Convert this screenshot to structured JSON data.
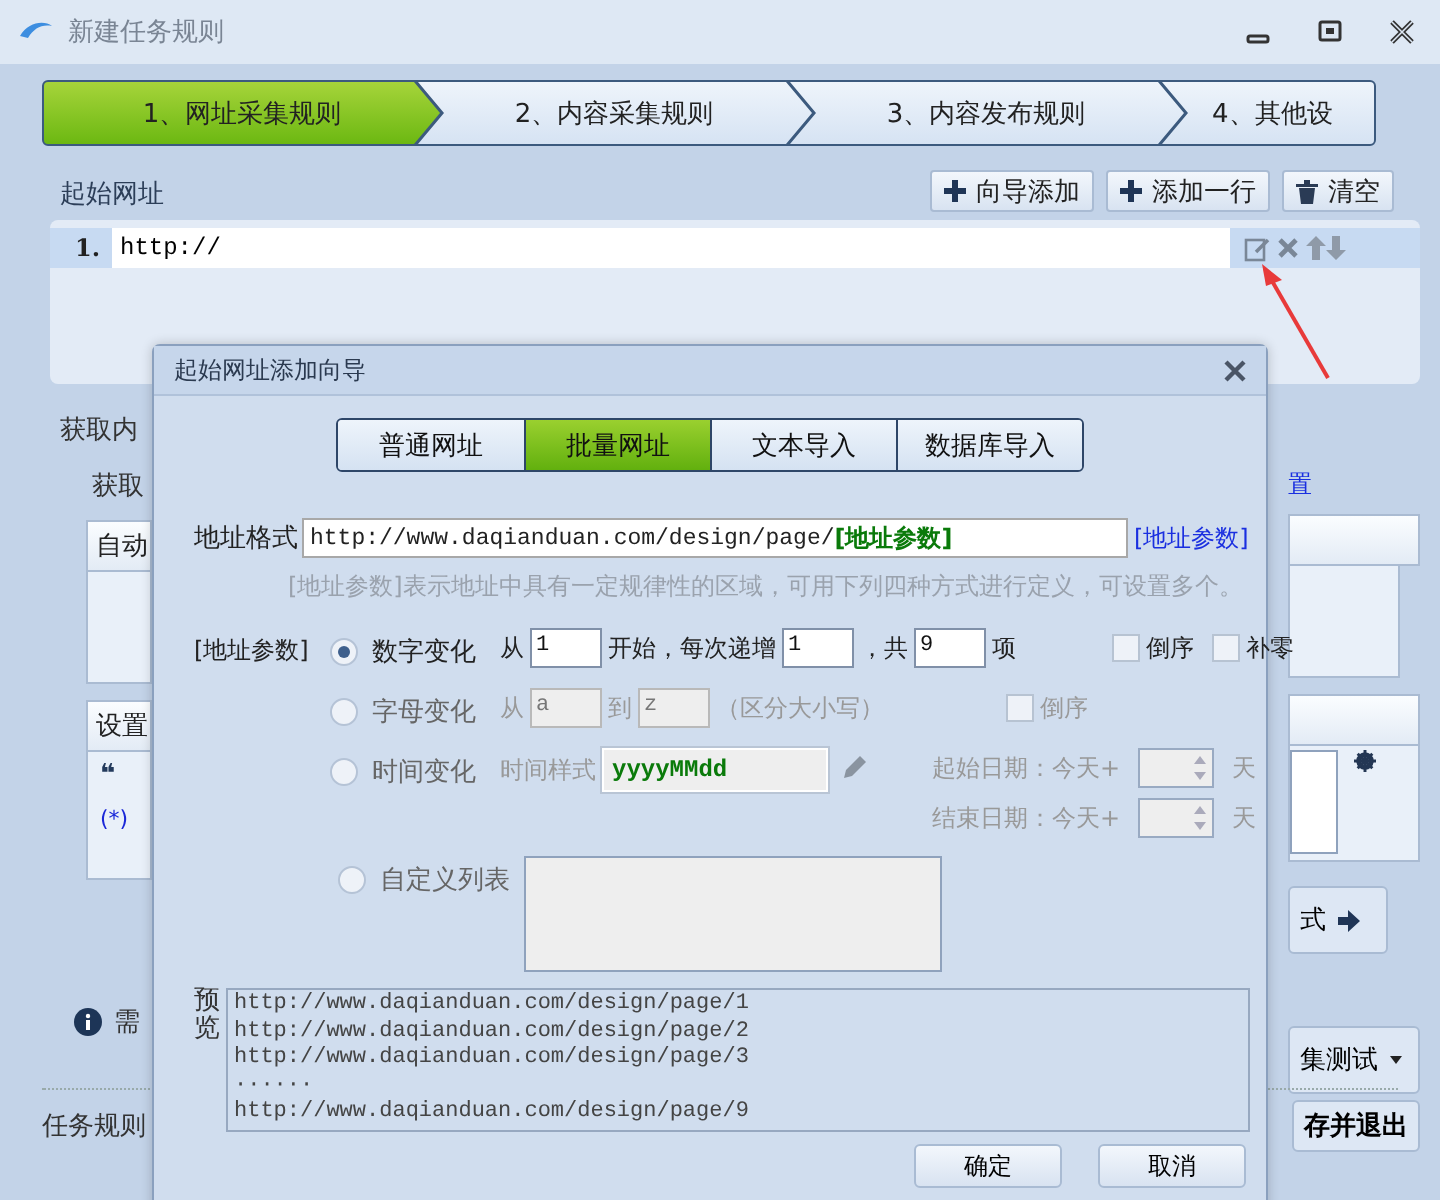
{
  "window": {
    "title": "新建任务规则"
  },
  "steps": [
    {
      "label": "1、网址采集规则",
      "selected": true
    },
    {
      "label": "2、内容采集规则",
      "selected": false
    },
    {
      "label": "3、内容发布规则",
      "selected": false
    },
    {
      "label": "4、其他设",
      "selected": false
    }
  ],
  "start_urls": {
    "title": "起始网址",
    "buttons": [
      {
        "label": "向导添加",
        "kind": "plus"
      },
      {
        "label": "添加一行",
        "kind": "plus"
      },
      {
        "label": "清空",
        "kind": "trash"
      }
    ],
    "rows": [
      {
        "index": "1.",
        "value": "http://"
      }
    ]
  },
  "content_section": {
    "title": "获取内",
    "method_label": "获取",
    "link": "置",
    "panels": [
      {
        "title": "自动"
      },
      {
        "title": "设置"
      }
    ],
    "quote": "❝",
    "wildcard": "(*)",
    "next_button": "式",
    "test_button": "集测试",
    "info": "需",
    "footer_label": "任务规则",
    "save_button": "存并退出"
  },
  "dialog": {
    "title": "起始网址添加向导",
    "tabs": [
      {
        "label": "普通网址",
        "selected": false
      },
      {
        "label": "批量网址",
        "selected": true
      },
      {
        "label": "文本导入",
        "selected": false
      },
      {
        "label": "数据库导入",
        "selected": false
      }
    ],
    "format": {
      "label": "地址格式",
      "value": "http://www.daqianduan.com/design/page/**[地址参数]**",
      "link": "[地址参数]"
    },
    "hint": "[地址参数]表示地址中具有一定规律性的区域，可用下列四种方式进行定义，可设置多个。",
    "param_label": "[地址参数]",
    "options": [
      {
        "kind": "number",
        "label": "数字变化",
        "selected": true,
        "from_label": "从",
        "from": "1",
        "step_label": "开始，每次递增",
        "step": "1",
        "count_label": "，共",
        "count": "9",
        "unit": "项",
        "checks": [
          {
            "label": "倒序",
            "checked": false
          },
          {
            "label": "补零",
            "checked": false
          }
        ]
      },
      {
        "kind": "letter",
        "label": "字母变化",
        "selected": false,
        "from_label": "从",
        "from": "a",
        "to_label": "到",
        "to": "z",
        "note": "（区分大小写）",
        "checks": [
          {
            "label": "倒序",
            "checked": false
          }
        ]
      },
      {
        "kind": "time",
        "label": "时间变化",
        "selected": false,
        "format_label": "时间样式",
        "format": "yyyyMMdd",
        "dates": [
          {
            "label": "起始日期：今天+",
            "unit": "天"
          },
          {
            "label": "结束日期：今天+",
            "unit": "天"
          }
        ]
      },
      {
        "kind": "custom",
        "label": "自定义列表",
        "selected": false
      }
    ],
    "preview": {
      "label": "预览",
      "lines": [
        "http://www.daqianduan.com/design/page/1",
        "http://www.daqianduan.com/design/page/2",
        "http://www.daqianduan.com/design/page/3",
        "······",
        "http://www.daqianduan.com/design/page/9"
      ]
    },
    "buttons": [
      "确定",
      "取消"
    ]
  }
}
